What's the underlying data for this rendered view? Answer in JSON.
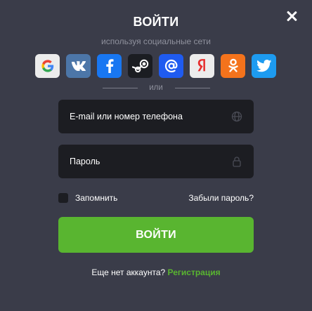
{
  "modal": {
    "title": "ВОЙТИ",
    "subtitle": "используя социальные сети",
    "close_icon": "close-icon"
  },
  "social": {
    "items": [
      {
        "name": "google",
        "icon": "google-icon",
        "color": "#ececec"
      },
      {
        "name": "vk",
        "icon": "vk-icon",
        "color": "#4c76a8"
      },
      {
        "name": "facebook",
        "icon": "facebook-icon",
        "color": "#1877f2"
      },
      {
        "name": "steam",
        "icon": "steam-icon",
        "color": "#1b1d22"
      },
      {
        "name": "mail",
        "icon": "at-icon",
        "color": "#1f5bf0"
      },
      {
        "name": "yandex",
        "icon": "yandex-icon",
        "color": "#ececec"
      },
      {
        "name": "odnoklassniki",
        "icon": "odnoklassniki-icon",
        "color": "#f4731c"
      },
      {
        "name": "twitter",
        "icon": "twitter-icon",
        "color": "#1d9bf0"
      }
    ]
  },
  "divider": {
    "text": "или"
  },
  "form": {
    "login_placeholder": "E-mail или номер телефона",
    "password_placeholder": "Пароль",
    "remember_label": "Запомнить",
    "forgot_label": "Забыли пароль?",
    "submit_label": "ВОЙТИ"
  },
  "footer": {
    "no_account_text": "Еще нет аккаунта?",
    "register_label": "Регистрация"
  },
  "colors": {
    "background": "#3a3c49",
    "field_bg": "#1c1d22",
    "accent": "#59b530"
  }
}
